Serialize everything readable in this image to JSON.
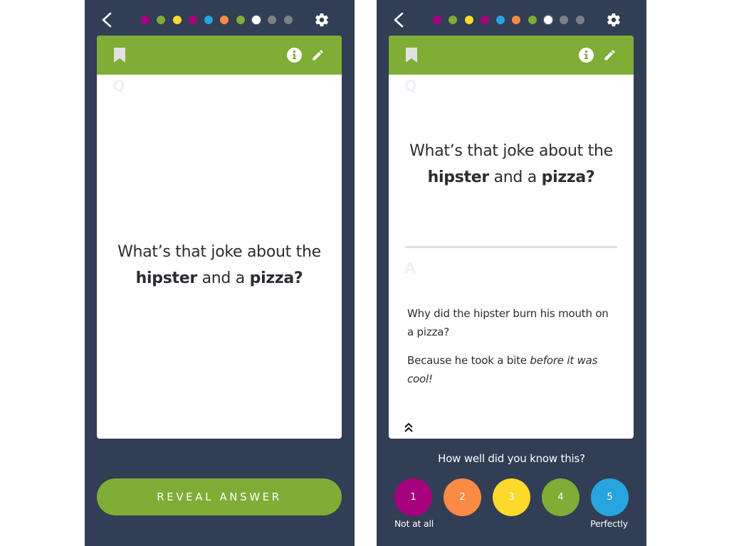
{
  "colors": {
    "background": "#313e54",
    "accent": "#7fad36",
    "magenta": "#a7007e",
    "green": "#7fad36",
    "yellow": "#fdd92b",
    "blue": "#28a5e0",
    "orange": "#fb8a45",
    "grey": "#7d8089",
    "white": "#ffffff"
  },
  "progress_dots": [
    {
      "color": "#a7007e",
      "state": "rated"
    },
    {
      "color": "#7fad36",
      "state": "rated"
    },
    {
      "color": "#fdd92b",
      "state": "rated"
    },
    {
      "color": "#a7007e",
      "state": "rated"
    },
    {
      "color": "#28a5e0",
      "state": "rated"
    },
    {
      "color": "#fb8a45",
      "state": "rated"
    },
    {
      "color": "#7fad36",
      "state": "rated"
    },
    {
      "color": "#ffffff",
      "state": "current"
    },
    {
      "color": "#7d8089",
      "state": "pending"
    },
    {
      "color": "#7d8089",
      "state": "pending"
    }
  ],
  "icons": {
    "back": "chevron-left-icon",
    "settings": "gear-icon",
    "bookmark": "bookmark-icon",
    "info": "info-icon",
    "edit": "pencil-icon",
    "collapse": "double-chevron-up-icon"
  },
  "card": {
    "question_marker": "Q",
    "answer_marker": "A",
    "question": {
      "part1": "What’s that joke about the",
      "bold1": "hipster",
      "part2": " and a ",
      "bold2": "pizza?"
    },
    "answer": {
      "line1": "Why did the hipster burn his mouth on a pizza?",
      "line2_plain": "Because he took a bite ",
      "line2_italic": "before it was cool!"
    }
  },
  "left_screen": {
    "reveal_button": "REVEAL ANSWER"
  },
  "right_screen": {
    "rating_prompt": "How well did you know this?",
    "rating_options": [
      {
        "value": "1",
        "color": "#a7007e"
      },
      {
        "value": "2",
        "color": "#fb8a45"
      },
      {
        "value": "3",
        "color": "#fdd92b"
      },
      {
        "value": "4",
        "color": "#7fad36"
      },
      {
        "value": "5",
        "color": "#28a5e0"
      }
    ],
    "rating_low_label": "Not at all",
    "rating_high_label": "Perfectly"
  }
}
